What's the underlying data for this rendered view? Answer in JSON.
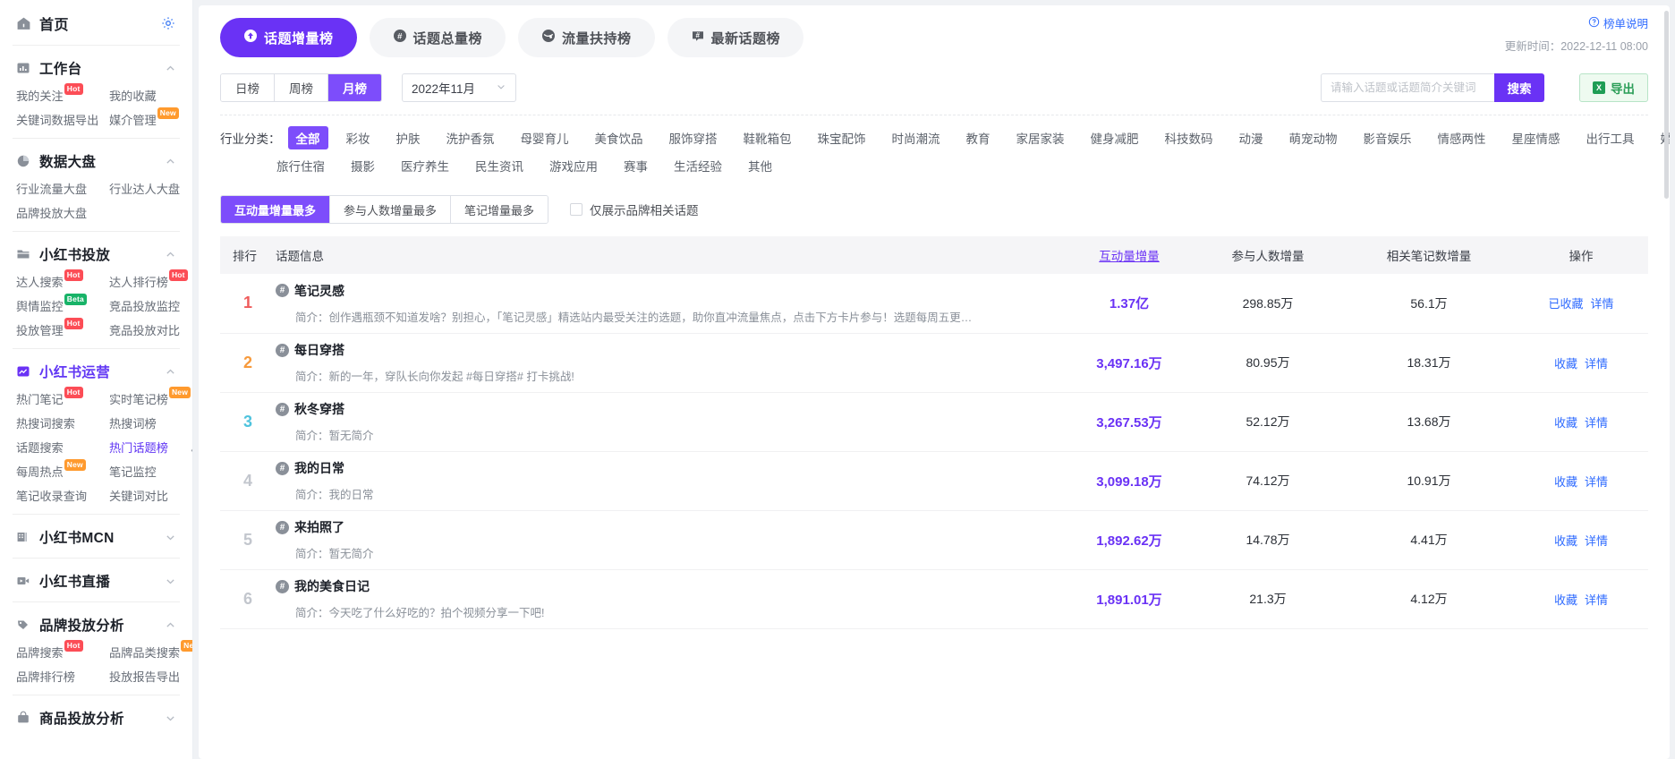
{
  "sidebar": {
    "home": {
      "label": "首页",
      "icon": "home-icon",
      "settings_icon": "gear-icon"
    },
    "groups": [
      {
        "title": "工作台",
        "icon": "dashboard-icon",
        "expanded": true,
        "accent": false,
        "links": [
          {
            "label": "我的关注",
            "tag": "Hot",
            "tag_type": "hot"
          },
          {
            "label": "我的收藏",
            "tag": "",
            "tag_type": ""
          },
          {
            "label": "关键词数据导出",
            "tag": "",
            "tag_type": ""
          },
          {
            "label": "媒介管理",
            "tag": "New",
            "tag_type": "new"
          }
        ]
      },
      {
        "title": "数据大盘",
        "icon": "pie-icon",
        "expanded": true,
        "accent": false,
        "links": [
          {
            "label": "行业流量大盘",
            "tag": "",
            "tag_type": ""
          },
          {
            "label": "行业达人大盘",
            "tag": "",
            "tag_type": ""
          },
          {
            "label": "品牌投放大盘",
            "tag": "",
            "tag_type": ""
          }
        ]
      },
      {
        "title": "小红书投放",
        "icon": "folder-icon",
        "expanded": true,
        "accent": false,
        "links": [
          {
            "label": "达人搜索",
            "tag": "Hot",
            "tag_type": "hot"
          },
          {
            "label": "达人排行榜",
            "tag": "Hot",
            "tag_type": "hot"
          },
          {
            "label": "舆情监控",
            "tag": "Beta",
            "tag_type": "beta"
          },
          {
            "label": "竞品投放监控",
            "tag": "",
            "tag_type": ""
          },
          {
            "label": "投放管理",
            "tag": "Hot",
            "tag_type": "hot"
          },
          {
            "label": "竞品投放对比",
            "tag": "",
            "tag_type": ""
          }
        ]
      },
      {
        "title": "小红书运营",
        "icon": "chart-icon",
        "expanded": true,
        "accent": true,
        "links": [
          {
            "label": "热门笔记",
            "tag": "Hot",
            "tag_type": "hot"
          },
          {
            "label": "实时笔记榜",
            "tag": "New",
            "tag_type": "new"
          },
          {
            "label": "热搜词搜索",
            "tag": "",
            "tag_type": ""
          },
          {
            "label": "热搜词榜",
            "tag": "",
            "tag_type": ""
          },
          {
            "label": "话题搜索",
            "tag": "",
            "tag_type": ""
          },
          {
            "label": "热门话题榜",
            "tag": "",
            "tag_type": "",
            "active": true
          },
          {
            "label": "每周热点",
            "tag": "New",
            "tag_type": "new"
          },
          {
            "label": "笔记监控",
            "tag": "",
            "tag_type": ""
          },
          {
            "label": "笔记收录查询",
            "tag": "",
            "tag_type": ""
          },
          {
            "label": "关键词对比",
            "tag": "",
            "tag_type": ""
          }
        ]
      },
      {
        "title": "小红书MCN",
        "icon": "building-icon",
        "expanded": false,
        "accent": false,
        "links": []
      },
      {
        "title": "小红书直播",
        "icon": "video-icon",
        "expanded": false,
        "accent": false,
        "links": []
      },
      {
        "title": "品牌投放分析",
        "icon": "tag-icon",
        "expanded": true,
        "accent": false,
        "links": [
          {
            "label": "品牌搜索",
            "tag": "Hot",
            "tag_type": "hot"
          },
          {
            "label": "品牌品类搜索",
            "tag": "New",
            "tag_type": "new"
          },
          {
            "label": "品牌排行榜",
            "tag": "",
            "tag_type": ""
          },
          {
            "label": "投放报告导出",
            "tag": "",
            "tag_type": ""
          }
        ]
      },
      {
        "title": "商品投放分析",
        "icon": "bag-icon",
        "expanded": false,
        "accent": false,
        "links": []
      }
    ],
    "collapse_icon": "«"
  },
  "header": {
    "tabs": [
      {
        "label": "话题增量榜",
        "icon": "arrow-up-circle-icon",
        "active": true
      },
      {
        "label": "话题总量榜",
        "icon": "hash-circle-icon",
        "active": false
      },
      {
        "label": "流量扶持榜",
        "icon": "traffic-circle-icon",
        "active": false
      },
      {
        "label": "最新话题榜",
        "icon": "hash-square-icon",
        "active": false
      }
    ],
    "help_label": "榜单说明",
    "help_icon": "question-circle-icon",
    "update_time": "更新时间：2022-12-11 08:00"
  },
  "filters": {
    "period_options": [
      {
        "label": "日榜",
        "active": false
      },
      {
        "label": "周榜",
        "active": false
      },
      {
        "label": "月榜",
        "active": true
      }
    ],
    "date_value": "2022年11月",
    "date_icon": "chevron-down-icon",
    "search_placeholder": "请输入话题或话题简介关键词",
    "search_value": "",
    "search_button": "搜索",
    "export_button": "导出",
    "export_icon": "excel-icon"
  },
  "categories": {
    "label": "行业分类：",
    "row1": [
      "全部",
      "彩妆",
      "护肤",
      "洗护香氛",
      "母婴育儿",
      "美食饮品",
      "服饰穿搭",
      "鞋靴箱包",
      "珠宝配饰",
      "时尚潮流",
      "教育",
      "家居家装",
      "健身减肥",
      "科技数码",
      "动漫",
      "萌宠动物",
      "影音娱乐",
      "情感两性",
      "星座情感",
      "出行工具",
      "婚嫁"
    ],
    "row2": [
      "旅行住宿",
      "摄影",
      "医疗养生",
      "民生资讯",
      "游戏应用",
      "赛事",
      "生活经验",
      "其他"
    ],
    "active": "全部"
  },
  "sorting": {
    "options": [
      {
        "label": "互动量增量最多",
        "active": true
      },
      {
        "label": "参与人数增量最多",
        "active": false
      },
      {
        "label": "笔记增量最多",
        "active": false
      }
    ],
    "checkbox_label": "仅展示品牌相关话题",
    "checkbox_checked": false
  },
  "table": {
    "columns": [
      "排行",
      "话题信息",
      "互动量增量",
      "参与人数增量",
      "相关笔记数增量",
      "操作"
    ],
    "sorted_column": "互动量增量",
    "rows": [
      {
        "rank": "1",
        "title": "笔记灵感",
        "desc": "简介：创作遇瓶颈不知道发啥？别担心，「笔记灵感」精选站内最受关注的选题，助你直冲流量焦点，点击下方卡片参与！选题每周五更新，记得常来get最新选题～",
        "interaction": "1.37亿",
        "participants": "298.85万",
        "notes": "56.1万",
        "fav_label": "已收藏",
        "detail_label": "详情"
      },
      {
        "rank": "2",
        "title": "每日穿搭",
        "desc": "简介：新的一年，穿队长向你发起 #每日穿搭# 打卡挑战!",
        "interaction": "3,497.16万",
        "participants": "80.95万",
        "notes": "18.31万",
        "fav_label": "收藏",
        "detail_label": "详情"
      },
      {
        "rank": "3",
        "title": "秋冬穿搭",
        "desc": "简介：暂无简介",
        "interaction": "3,267.53万",
        "participants": "52.12万",
        "notes": "13.68万",
        "fav_label": "收藏",
        "detail_label": "详情"
      },
      {
        "rank": "4",
        "title": "我的日常",
        "desc": "简介：我的日常",
        "interaction": "3,099.18万",
        "participants": "74.12万",
        "notes": "10.91万",
        "fav_label": "收藏",
        "detail_label": "详情"
      },
      {
        "rank": "5",
        "title": "来拍照了",
        "desc": "简介：暂无简介",
        "interaction": "1,892.62万",
        "participants": "14.78万",
        "notes": "4.41万",
        "fav_label": "收藏",
        "detail_label": "详情"
      },
      {
        "rank": "6",
        "title": "我的美食日记",
        "desc": "简介：今天吃了什么好吃的？拍个视频分享一下吧!",
        "interaction": "1,891.01万",
        "participants": "21.3万",
        "notes": "4.12万",
        "fav_label": "收藏",
        "detail_label": "详情"
      }
    ]
  },
  "colors": {
    "accent": "#6a32f5",
    "accent_light": "#7d4dfb",
    "link": "#2f6bff",
    "rank1": "#ef5b5b",
    "rank2": "#f79a3c",
    "rank3": "#4fc3dd"
  }
}
